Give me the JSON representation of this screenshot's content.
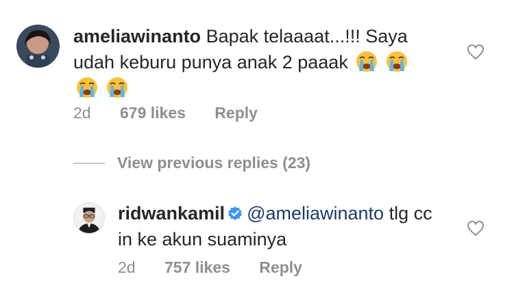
{
  "comments": [
    {
      "username": "ameliawinanto",
      "text": "Bapak telaaaat...!!! Saya udah keburu punya anak 2 paaak",
      "emoji": "loudly-crying-face",
      "time": "2d",
      "likes": "679 likes",
      "reply_label": "Reply"
    },
    {
      "username": "ridwankamil",
      "verified": true,
      "mention": "@ameliawinanto",
      "text": "tlg cc in ke akun suaminya",
      "time": "2d",
      "likes": "757 likes",
      "reply_label": "Reply"
    }
  ],
  "view_replies": "View previous replies (23)",
  "icons": {
    "like": "heart-outline-icon",
    "verified": "verified-badge-icon"
  },
  "colors": {
    "text": "#262626",
    "meta": "#8e8e8e",
    "mention": "#1e3a6e",
    "verified": "#3897f0"
  }
}
